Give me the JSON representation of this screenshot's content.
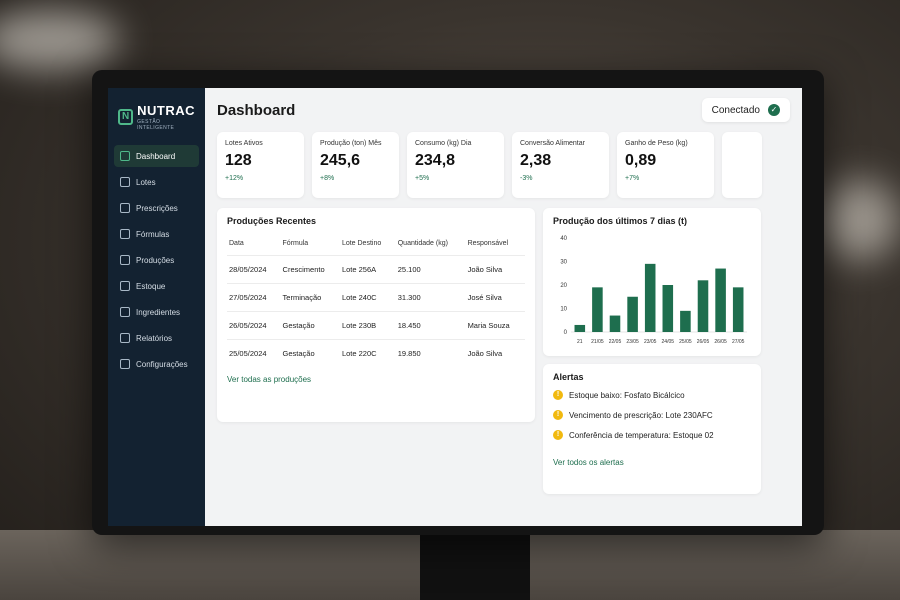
{
  "brand": {
    "name": "NUTRAC",
    "tagline": "GESTÃO INTELIGENTE",
    "accent": "#1e6e4e"
  },
  "sidebar": {
    "items": [
      {
        "label": "Dashboard",
        "icon": "home-icon",
        "active": true
      },
      {
        "label": "Lotes",
        "icon": "box-icon"
      },
      {
        "label": "Prescrições",
        "icon": "clipboard-icon"
      },
      {
        "label": "Fórmulas",
        "icon": "flask-icon"
      },
      {
        "label": "Produções",
        "icon": "factory-icon"
      },
      {
        "label": "Estoque",
        "icon": "warehouse-icon"
      },
      {
        "label": "Ingredientes",
        "icon": "ingredients-icon"
      },
      {
        "label": "Relatórios",
        "icon": "report-icon"
      },
      {
        "label": "Configurações",
        "icon": "gear-icon"
      }
    ]
  },
  "header": {
    "title": "Dashboard",
    "status": "Conectado",
    "status_icon": "check-icon"
  },
  "kpis": [
    {
      "label": "Lotes Ativos",
      "value": "128",
      "delta": "+12%"
    },
    {
      "label": "Produção (ton) Mês",
      "value": "245,6",
      "delta": "+8%"
    },
    {
      "label": "Consumo (kg) Dia",
      "value": "234,8",
      "delta": "+5%"
    },
    {
      "label": "Conversão Alimentar",
      "value": "2,38",
      "delta": "-3%"
    },
    {
      "label": "Ganho de Peso (kg)",
      "value": "0,89",
      "delta": "+7%"
    }
  ],
  "productions": {
    "title": "Produções Recentes",
    "columns": [
      "Data",
      "Fórmula",
      "Lote Destino",
      "Quantidade (kg)",
      "Responsável"
    ],
    "rows": [
      [
        "28/05/2024",
        "Crescimento",
        "Lote 256A",
        "25.100",
        "João Silva"
      ],
      [
        "27/05/2024",
        "Terminação",
        "Lote 240C",
        "31.300",
        "José Silva"
      ],
      [
        "26/05/2024",
        "Gestação",
        "Lote 230B",
        "18.450",
        "Maria Souza"
      ],
      [
        "25/05/2024",
        "Gestação",
        "Lote 220C",
        "19.850",
        "João Silva"
      ]
    ],
    "link": "Ver todas as produções"
  },
  "chart_data": {
    "type": "bar",
    "title": "Produção dos últimos 7 dias (t)",
    "categories": [
      "21",
      "21/05",
      "22/05",
      "23/05",
      "23/05",
      "24/05",
      "25/05",
      "26/05",
      "26/05",
      "27/05"
    ],
    "values": [
      3,
      19,
      7,
      15,
      29,
      20,
      9,
      22,
      27,
      19
    ],
    "yticks": [
      0,
      10,
      20,
      30,
      40
    ],
    "ylim": [
      0,
      40
    ],
    "color": "#1e6e4e"
  },
  "alerts": {
    "title": "Alertas",
    "items": [
      "Estoque baixo: Fosfato Bicálcico",
      "Vencimento de prescrição: Lote 230AFC",
      "Conferência de temperatura: Estoque 02"
    ],
    "icon": "warning-icon",
    "link": "Ver todos os alertas"
  }
}
